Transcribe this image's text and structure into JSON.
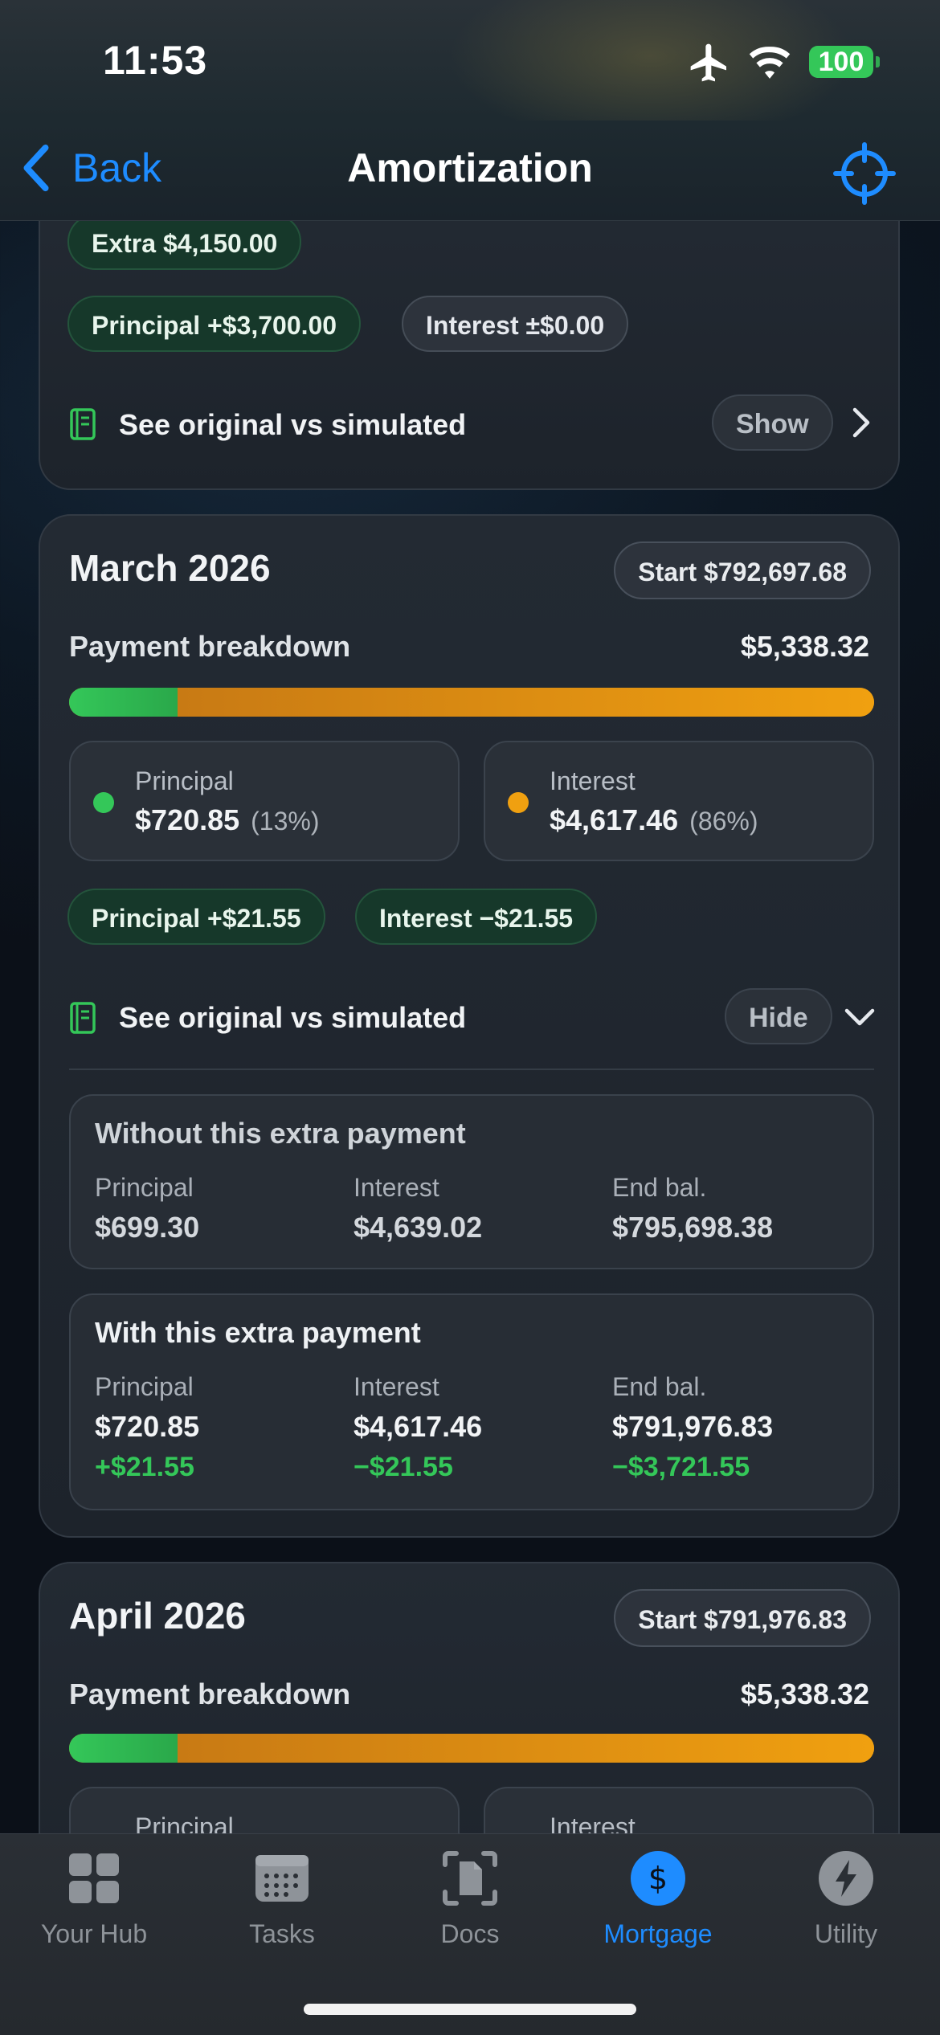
{
  "status_bar": {
    "time": "11:53",
    "battery": "100"
  },
  "nav": {
    "back_label": "Back",
    "title": "Amortization"
  },
  "card_top": {
    "pill_extra": "Extra $4,150.00",
    "pill_principal": "Principal +$3,700.00",
    "pill_interest": "Interest ±$0.00",
    "compare_label": "See original vs simulated",
    "toggle_label": "Show"
  },
  "card_march": {
    "month": "March 2026",
    "start": "Start $792,697.68",
    "breakdown_label": "Payment breakdown",
    "breakdown_total": "$5,338.32",
    "principal_fraction": 0.135,
    "principal_label": "Principal",
    "principal_value": "$720.85",
    "principal_pct": "(13%)",
    "interest_label": "Interest",
    "interest_value": "$4,617.46",
    "interest_pct": "(86%)",
    "pill_principal": "Principal +$21.55",
    "pill_interest": "Interest −$21.55",
    "compare_label": "See original vs simulated",
    "toggle_label": "Hide",
    "without": {
      "title": "Without this extra payment",
      "principal_h": "Principal",
      "principal_v": "$699.30",
      "interest_h": "Interest",
      "interest_v": "$4,639.02",
      "endbal_h": "End bal.",
      "endbal_v": "$795,698.38"
    },
    "with": {
      "title": "With this extra payment",
      "principal_h": "Principal",
      "principal_v": "$720.85",
      "principal_d": "+$21.55",
      "interest_h": "Interest",
      "interest_v": "$4,617.46",
      "interest_d": "−$21.55",
      "endbal_h": "End bal.",
      "endbal_v": "$791,976.83",
      "endbal_d": "−$3,721.55"
    }
  },
  "card_april": {
    "month": "April 2026",
    "start": "Start $791,976.83",
    "breakdown_label": "Payment breakdown",
    "breakdown_total": "$5,338.32",
    "principal_fraction": 0.135,
    "principal_label": "Principal",
    "interest_label": "Interest"
  },
  "tabs": [
    {
      "label": "Your Hub",
      "icon": "grid-icon"
    },
    {
      "label": "Tasks",
      "icon": "calendar-icon"
    },
    {
      "label": "Docs",
      "icon": "document-scan-icon"
    },
    {
      "label": "Mortgage",
      "icon": "dollar-circle-icon",
      "active": true
    },
    {
      "label": "Utility",
      "icon": "bolt-circle-icon"
    }
  ],
  "colors": {
    "accent": "#1e8cff",
    "principal": "#34c759",
    "interest": "#f0a010"
  }
}
